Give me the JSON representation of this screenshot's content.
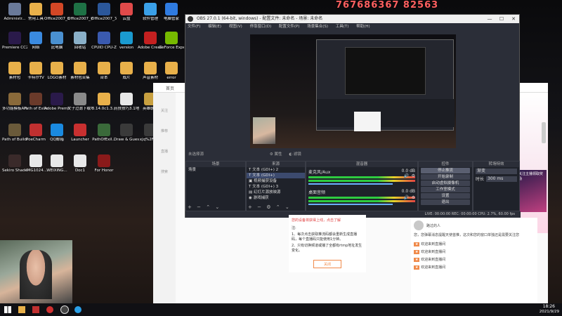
{
  "desktop": {
    "icons": [
      {
        "label": "Administr...",
        "color": "#6a7a9a"
      },
      {
        "label": "常用工具",
        "color": "#e8b04a"
      },
      {
        "label": "Office2007_幻灯片PPT",
        "color": "#d24726"
      },
      {
        "label": "Office2007_表格",
        "color": "#1e7145"
      },
      {
        "label": "Office2007_文字",
        "color": "#2b579a"
      },
      {
        "label": "云盘",
        "color": "#e04a4a"
      },
      {
        "label": "软件管理",
        "color": "#3aa0e8"
      },
      {
        "label": "电脑管家",
        "color": "#2f7be0"
      },
      {
        "label": "Premiere CC2019",
        "color": "#2a1a4a"
      },
      {
        "label": "网络",
        "color": "#3a8ae0"
      },
      {
        "label": "此电脑",
        "color": "#4a90d0"
      },
      {
        "label": "回收站",
        "color": "#8ab0c8"
      },
      {
        "label": "CPUID CPU-Z",
        "color": "#3a5ab0"
      },
      {
        "label": "version",
        "color": "#1a9ad0"
      },
      {
        "label": "Adobe Creati...",
        "color": "#c42020"
      },
      {
        "label": "GeForce Experience",
        "color": "#76b900"
      },
      {
        "label": "素材包",
        "color": "#e8b04a"
      },
      {
        "label": "卡特尔TV",
        "color": "#e8b04a"
      },
      {
        "label": "LOGO素材",
        "color": "#e8b04a"
      },
      {
        "label": "素材包合集",
        "color": "#e8b04a"
      },
      {
        "label": "台本",
        "color": "#e8b04a"
      },
      {
        "label": "成片",
        "color": "#e8b04a"
      },
      {
        "label": "声音素材",
        "color": "#e8b04a"
      },
      {
        "label": "error",
        "color": "#e8b04a"
      },
      {
        "label": "多功能模板AHK",
        "color": "#8a6a3a"
      },
      {
        "label": "Path of Exile",
        "color": "#6a3a2a"
      },
      {
        "label": "Adobe Premie...",
        "color": "#2a1a4a"
      },
      {
        "label": "文子过滤下载地址",
        "color": "#8a8a8a"
      },
      {
        "label": "3.14.0c1.3...",
        "color": "#e8b04a"
      },
      {
        "label": "药技技巧3.1地图",
        "color": "#e8e8e8"
      },
      {
        "label": "英雄联盟",
        "color": "#c8a040"
      },
      {
        "label": "多功能模板AHK20.19...",
        "color": "#8a6a3a"
      },
      {
        "label": "Path of Building",
        "color": "#6a5a3a"
      },
      {
        "label": "PoeCharm",
        "color": "#c03030"
      },
      {
        "label": "QQ邮箱",
        "color": "#1a8ae0"
      },
      {
        "label": "Launcher",
        "color": "#c83030"
      },
      {
        "label": "PathOfExil...",
        "color": "#3a6a3a"
      },
      {
        "label": "Draw & Guess",
        "color": "#3a3a3a"
      },
      {
        "label": "xjq%2Fnl...",
        "color": "#3a3a3a"
      },
      {
        "label": "QQ 浏览器",
        "color": "#1a8ae0"
      },
      {
        "label": "Sekiro Shadows Die...",
        "color": "#3a2a2a"
      },
      {
        "label": "-IMG1024...",
        "color": "#e8e8e8"
      },
      {
        "label": "WEIXING...",
        "color": "#e8e8e8"
      },
      {
        "label": "Doc1",
        "color": "#e8e8e8"
      },
      {
        "label": "For Honor",
        "color": "#8a1a1a"
      }
    ]
  },
  "overlay": {
    "text": "767686367 82563"
  },
  "obs": {
    "title": "OBS 27.0.1 (64-bit, windows) - 配置文件: 未命名 - 场景: 未命名",
    "menu": [
      "文件(F)",
      "编辑(E)",
      "视图(V)",
      "停靠窗口(D)",
      "配置文件(P)",
      "场景集合(S)",
      "工具(T)",
      "帮助(H)"
    ],
    "scene_bar": "未选择源",
    "props_label": "属性",
    "filters_label": "滤镜",
    "docks": {
      "scenes": {
        "header": "场景",
        "items": [
          "场景"
        ]
      },
      "sources": {
        "header": "来源",
        "items": [
          "文本 (GDI+) 2",
          "文本 (GDI+)",
          "视频捕获设备",
          "文本 (GDI+) 3",
          "幻灯片源放映源",
          "游戏捕获"
        ]
      },
      "mixer": {
        "header": "混音器",
        "channels": [
          {
            "name": "麦克风/Aux",
            "db": "0.0 dB"
          },
          {
            "name": "桌面音频",
            "db": "0.0 dB"
          }
        ]
      },
      "controls": {
        "header": "控件",
        "buttons": [
          "停止推流",
          "开始录制",
          "启动虚拟摄像机",
          "工作室模式",
          "设置",
          "退出"
        ]
      },
      "transitions": {
        "header": "转场特效",
        "type": "渐变",
        "duration_label": "时长",
        "duration": "300 ms"
      }
    },
    "status": "LIVE: 00:00:00  REC: 00:00:00  CPU: 2.7%, 60.00 fps"
  },
  "browser": {
    "nav": [
      "首页",
      "关注",
      "推荐",
      "直播",
      "搜索"
    ],
    "dialog": {
      "warn": "您的设备将获得上线，点击了解",
      "note_title": "注:",
      "notes": [
        "1、每次点击获取推流码都会重新生成直播码，每个直播码只能使用1分钟。",
        "2、只有切换频道或播了全都有rtmp地址发生变化。"
      ],
      "confirm": "关闭"
    },
    "chat": {
      "user": "路过的人",
      "message": "您，您弹幕消息提醒天使首推，这次和您的窗口单独还是需要关注您",
      "entries": [
        "欢迎来到直播间",
        "欢迎来到直播间",
        "欢迎来到直播间",
        "欢迎来到直播间"
      ]
    },
    "banner": "关注主播领取奖励"
  },
  "taskbar": {
    "time": "18:26",
    "date": "2021/9/29"
  }
}
